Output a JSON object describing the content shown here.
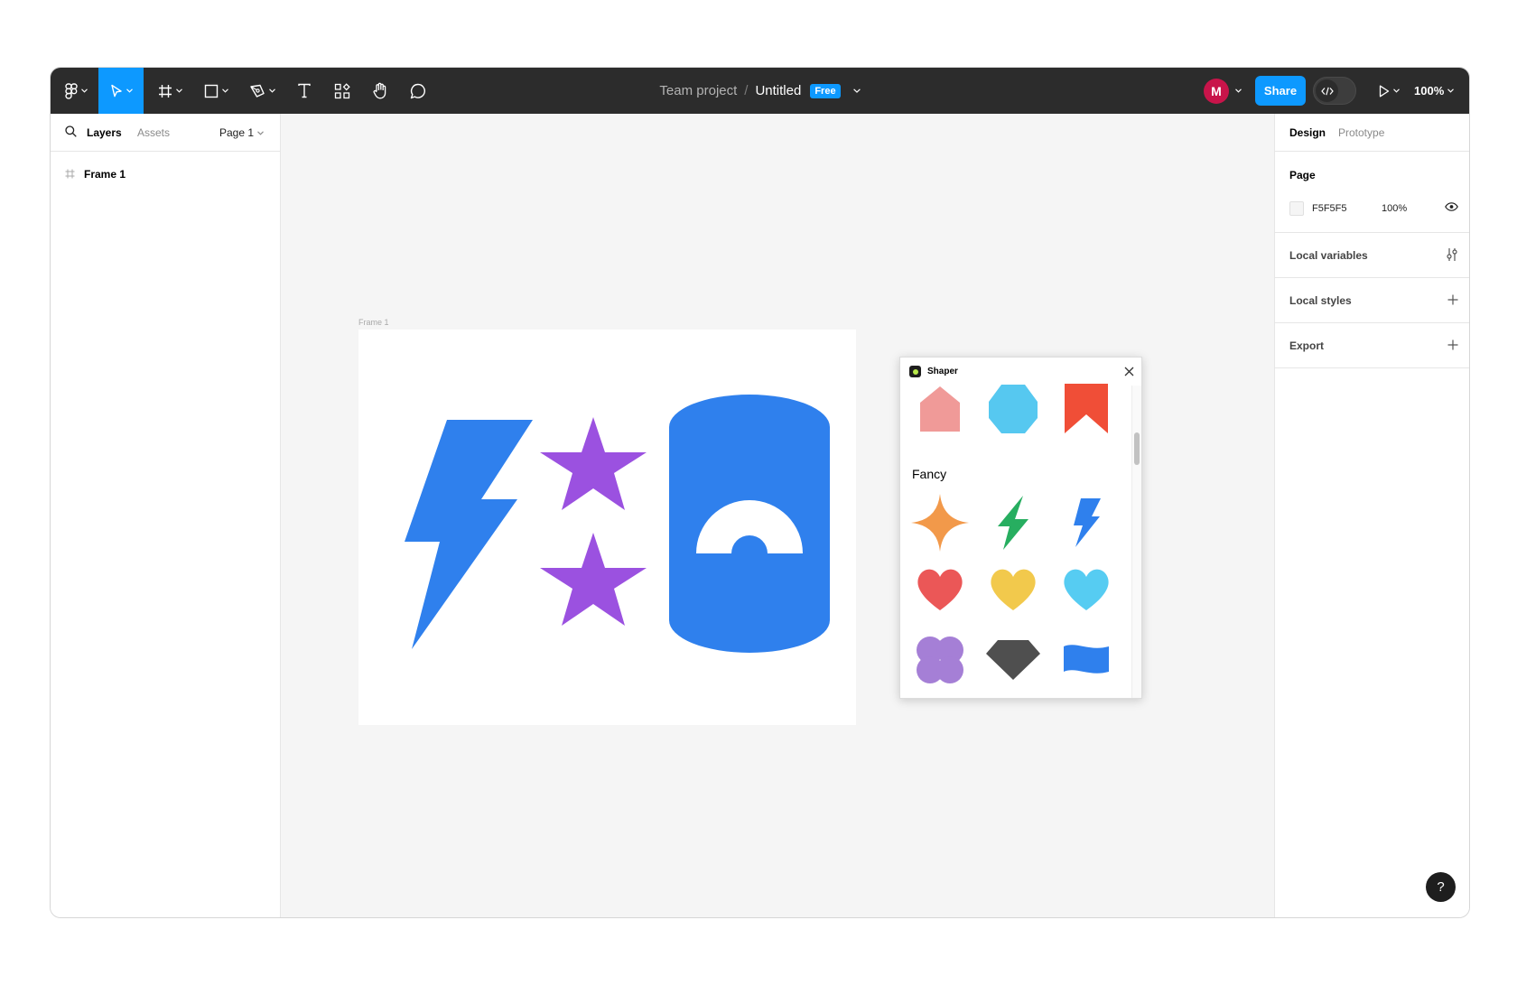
{
  "toolbar": {
    "icons": [
      "figma-menu-icon",
      "move-tool-icon",
      "frame-tool-icon",
      "shape-tool-icon",
      "pen-tool-icon",
      "text-tool-icon",
      "resources-icon",
      "hand-tool-icon",
      "comment-icon"
    ],
    "breadcrumb_team": "Team project",
    "breadcrumb_sep": "/",
    "file_name": "Untitled",
    "plan_badge": "Free",
    "avatar_initial": "M",
    "avatar_color": "#c8144a",
    "share_label": "Share",
    "zoom_label": "100%",
    "accent": "#0d99ff"
  },
  "left_panel": {
    "tabs": [
      {
        "label": "Layers"
      },
      {
        "label": "Assets"
      }
    ],
    "page_selector": "Page 1",
    "layers": [
      {
        "label": "Frame 1",
        "icon": "frame-icon"
      }
    ]
  },
  "right_panel": {
    "tabs": [
      {
        "label": "Design"
      },
      {
        "label": "Prototype"
      }
    ],
    "page": {
      "title": "Page",
      "color_hex": "F5F5F5",
      "opacity": "100%"
    },
    "sections": [
      {
        "label": "Local variables",
        "icon": "variables-icon"
      },
      {
        "label": "Local styles",
        "icon": "plus-icon"
      },
      {
        "label": "Export",
        "icon": "plus-icon"
      }
    ]
  },
  "canvas": {
    "frame_label": "Frame 1",
    "shapes": [
      {
        "name": "lightning-bolt",
        "color": "#2f80ed"
      },
      {
        "name": "star-top",
        "color": "#9b51e0"
      },
      {
        "name": "star-bottom",
        "color": "#9b51e0"
      },
      {
        "name": "cylinder-gauge",
        "color": "#2f80ed"
      }
    ]
  },
  "plugin": {
    "title": "Shaper",
    "section_label": "Fancy",
    "shapes": [
      {
        "name": "house",
        "color": "#f09a98"
      },
      {
        "name": "hexagon",
        "color": "#56c8f0"
      },
      {
        "name": "bookmark",
        "color": "#f04e37"
      },
      {
        "name": "sparkle",
        "color": "#f2994a"
      },
      {
        "name": "lightning-green",
        "color": "#27ae60"
      },
      {
        "name": "lightning-blue",
        "color": "#2f80ed"
      },
      {
        "name": "heart-red",
        "color": "#eb5757"
      },
      {
        "name": "heart-yellow",
        "color": "#f2c94c"
      },
      {
        "name": "heart-cyan",
        "color": "#56ccf2"
      },
      {
        "name": "clover",
        "color": "#a57fd6"
      },
      {
        "name": "diamond",
        "color": "#4f4f4f"
      },
      {
        "name": "flag-wave",
        "color": "#2f80ed"
      }
    ]
  },
  "help_label": "?"
}
